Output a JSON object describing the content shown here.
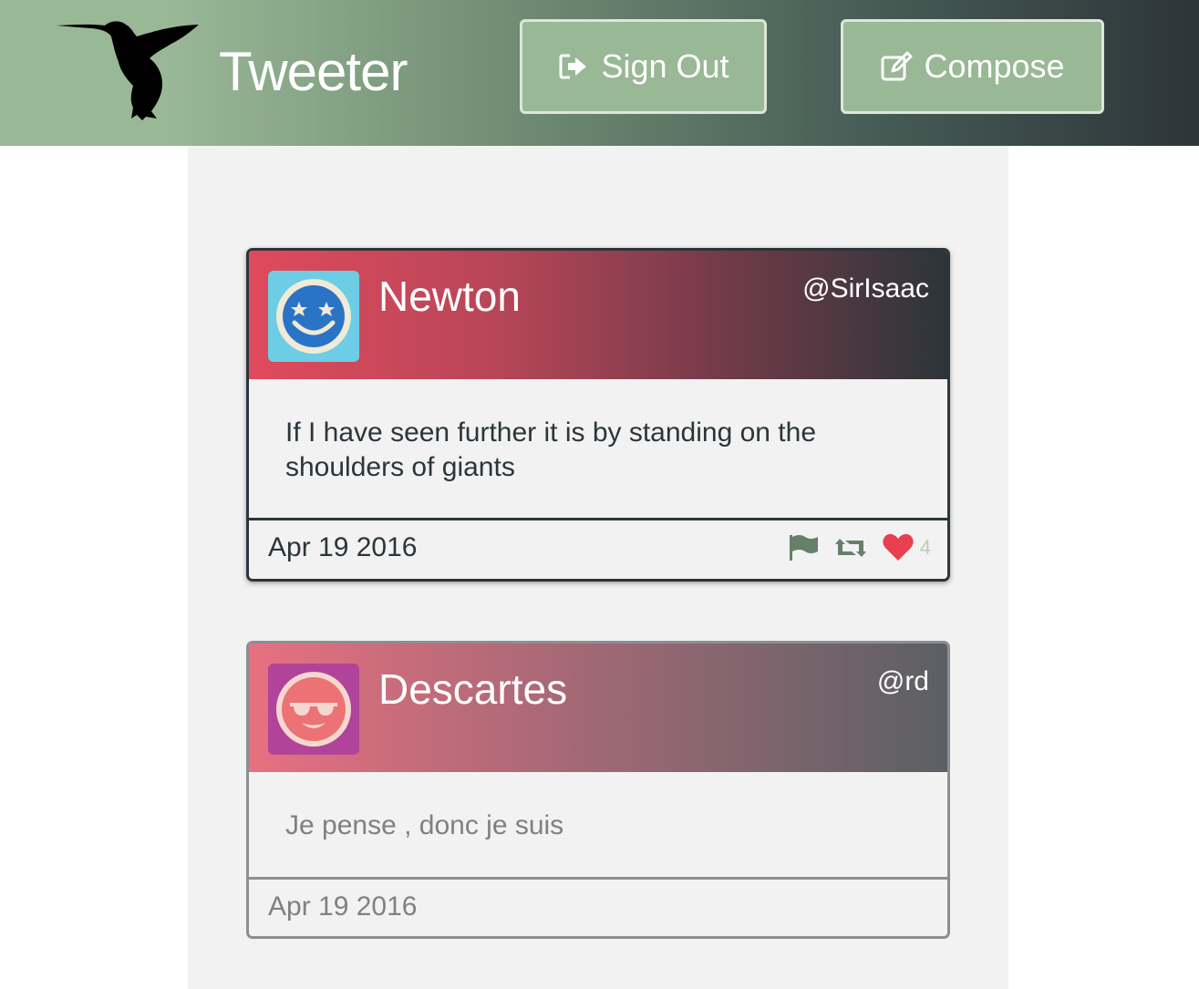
{
  "nav": {
    "brand": "Tweeter",
    "signout_label": "Sign Out",
    "compose_label": "Compose"
  },
  "colors": {
    "brand_green": "#99b896",
    "dark": "#2c3539",
    "like_red": "#e8404e",
    "feed_bg": "#f2f2f2"
  },
  "tweets": [
    {
      "name": "Newton",
      "handle": "@SirIsaac",
      "avatar_icon": "star-eyes-smiley-icon",
      "text": "If I have seen further it is by standing on the shoulders of giants",
      "date": "Apr 19 2016",
      "likes": "4",
      "actions": [
        "flag-icon",
        "retweet-icon",
        "heart-icon"
      ]
    },
    {
      "name": "Descartes",
      "handle": "@rd",
      "avatar_icon": "sunglasses-smiley-icon",
      "text": "Je pense , donc je suis",
      "date": "Apr 19 2016"
    }
  ]
}
